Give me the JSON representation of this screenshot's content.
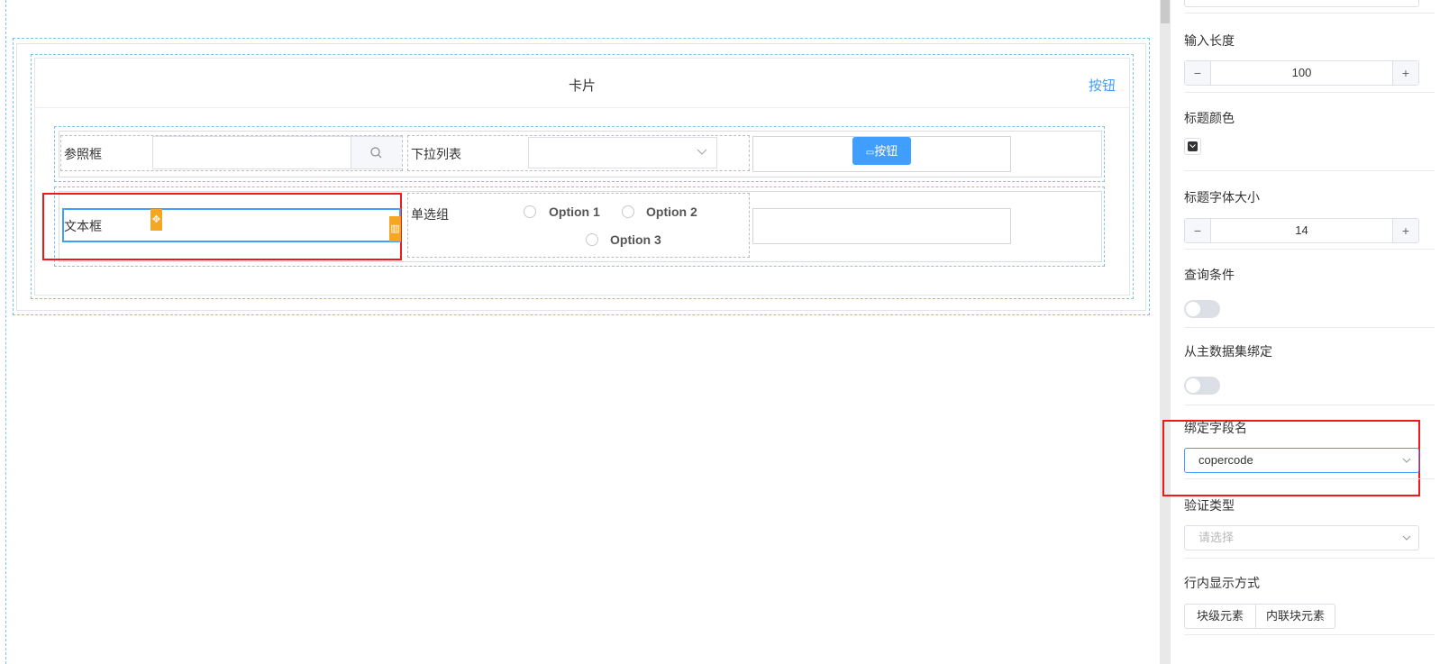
{
  "card": {
    "title": "卡片",
    "header_button": "按钮"
  },
  "form": {
    "ref_label": "参照框",
    "dropdown_label": "下拉列表",
    "action_button": "按钮",
    "text_label": "文本框",
    "radio_label": "单选组",
    "radio_options": [
      "Option 1",
      "Option 2",
      "Option 3"
    ]
  },
  "panel": {
    "input_length_label": "输入长度",
    "input_length_value": "100",
    "title_color_label": "标题颜色",
    "title_font_size_label": "标题字体大小",
    "title_font_size_value": "14",
    "query_condition_label": "查询条件",
    "bind_master_label": "从主数据集绑定",
    "bind_field_label": "绑定字段名",
    "bind_field_value": "copercode",
    "validation_type_label": "验证类型",
    "validation_type_placeholder": "请选择",
    "inline_display_label": "行内显示方式",
    "inline_options": [
      "块级元素",
      "内联块元素"
    ],
    "stepper_minus": "−",
    "stepper_plus": "+"
  },
  "colors": {
    "accent": "#409eff",
    "highlight": "#f01818",
    "handle": "#f5a623"
  }
}
